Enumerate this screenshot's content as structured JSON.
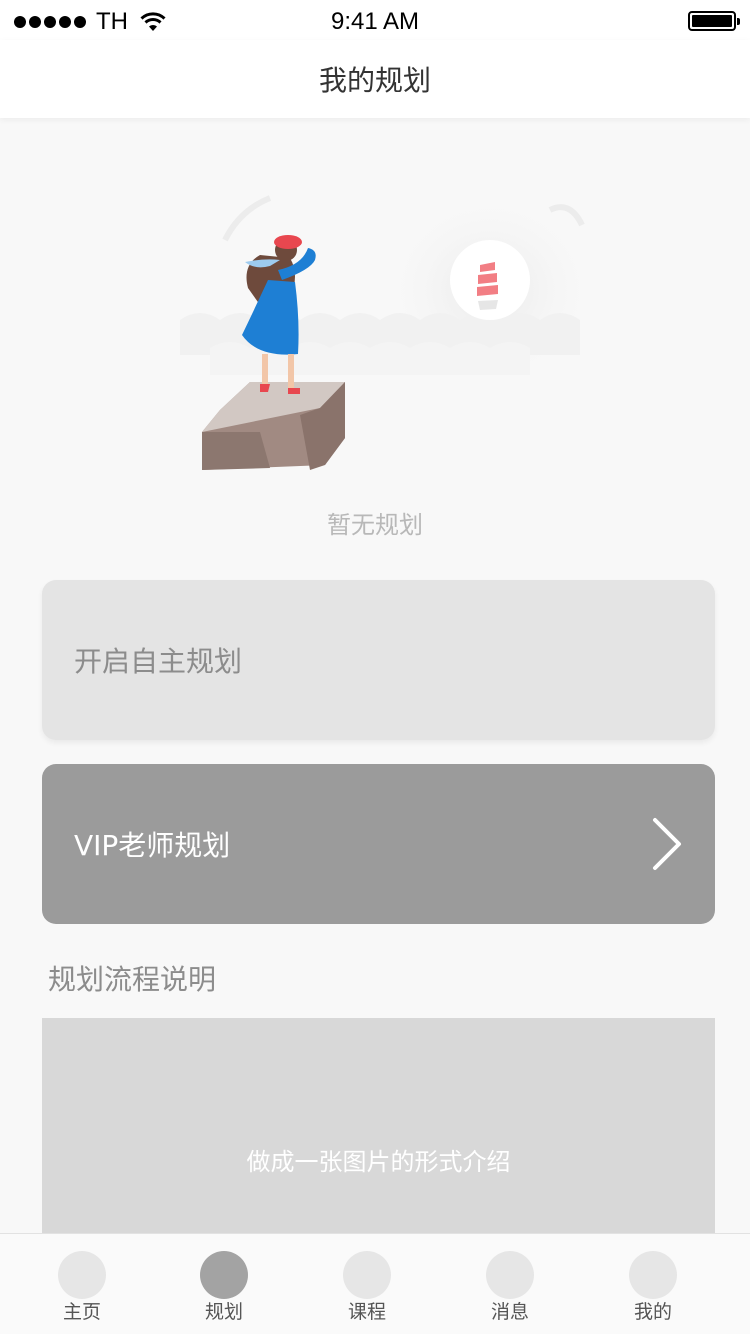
{
  "status_bar": {
    "carrier": "TH",
    "time": "9:41 AM"
  },
  "navbar": {
    "title": "我的规划"
  },
  "empty_state": {
    "text": "暂无规划"
  },
  "cards": {
    "self_plan_label": "开启自主规划",
    "vip_plan_label": "VIP老师规划"
  },
  "section": {
    "title": "规划流程说明",
    "image_placeholder": "做成一张图片的形式介绍"
  },
  "tabbar": {
    "items": [
      {
        "label": "主页",
        "active": false
      },
      {
        "label": "规划",
        "active": true
      },
      {
        "label": "课程",
        "active": false
      },
      {
        "label": "消息",
        "active": false
      },
      {
        "label": "我的",
        "active": false
      }
    ]
  },
  "colors": {
    "vip_card": "#9b9b9b",
    "self_card": "#e4e4e4",
    "active_tab": "#a3a3a3",
    "inactive_tab": "#e6e6e6",
    "accent_red": "#e8474f",
    "dress_blue": "#1e7fd4"
  }
}
